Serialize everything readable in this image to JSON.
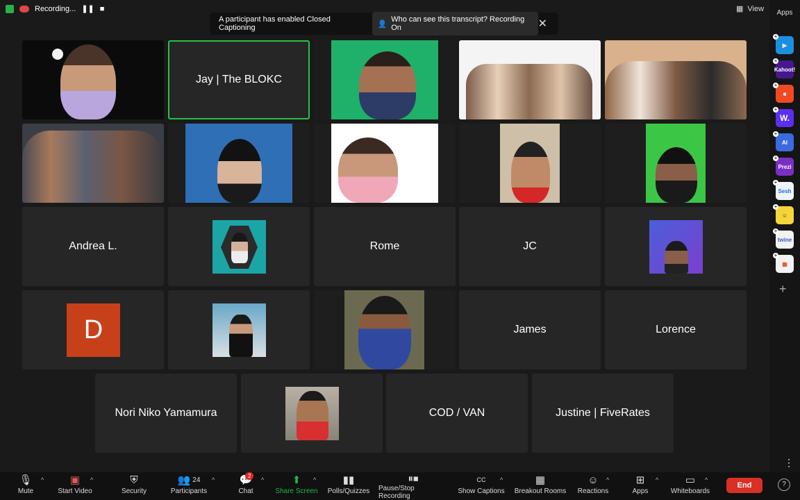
{
  "top": {
    "recording_label": "Recording...",
    "view_label": "View",
    "apps_label": "Apps",
    "banner_message": "A participant has enabled Closed Captioning",
    "banner_chip": "Who can see this transcript? Recording On"
  },
  "tiles": {
    "jay": "Jay | The BLOKC",
    "andrea": "Andrea L.",
    "rome": "Rome",
    "jc": "JC",
    "d_initial": "D",
    "james": "James",
    "lorence": "Lorence",
    "nori": "Nori Niko Yamamura",
    "cod": "COD / VAN",
    "justine": "Justine | FiveRates"
  },
  "apps": {
    "kahoot": "Kahoot!",
    "w": "W.",
    "prezi": "Prezi",
    "sesh": "Sesh",
    "twine": "twine",
    "ai": "AI"
  },
  "toolbar": {
    "mute": "Mute",
    "start_video": "Start Video",
    "security": "Security",
    "participants": "Participants",
    "participants_count": "24",
    "chat": "Chat",
    "chat_badge": "2",
    "share_screen": "Share Screen",
    "polls": "Polls/Quizzes",
    "pause_stop": "Pause/Stop Recording",
    "captions": "Show Captions",
    "captions_icon": "CC",
    "breakout": "Breakout Rooms",
    "reactions": "Reactions",
    "apps": "Apps",
    "whiteboards": "Whiteboards",
    "end": "End"
  },
  "colors": {
    "accent_green": "#2ac14a",
    "end_red": "#d93025",
    "share_green": "#1fb84b"
  }
}
